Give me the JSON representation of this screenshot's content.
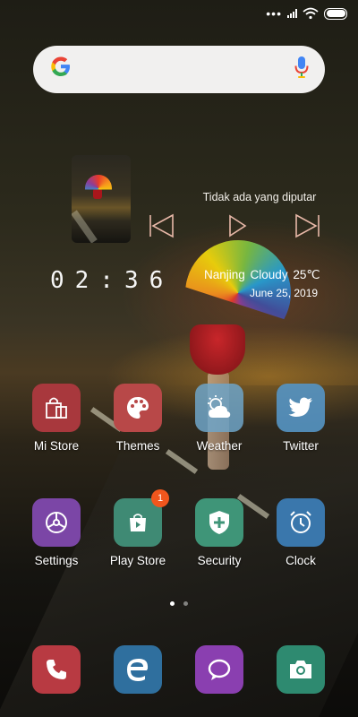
{
  "status_bar": {
    "notification_dots": "•••"
  },
  "search": {
    "logo": "G",
    "placeholder": ""
  },
  "music_widget": {
    "track_title": "Tidak ada yang diputar"
  },
  "clock_widget": {
    "time": "02:36"
  },
  "weather_widget": {
    "city": "Nanjing",
    "condition": "Cloudy",
    "temperature": "25℃",
    "date": "June  25, 2019"
  },
  "apps": [
    {
      "label": "Mi Store",
      "icon": "shopping-bag-icon",
      "color": "#a8383d"
    },
    {
      "label": "Themes",
      "icon": "palette-icon",
      "color": "#b84848"
    },
    {
      "label": "Weather",
      "icon": "weather-icon",
      "color": "#6aa3c7"
    },
    {
      "label": "Twitter",
      "icon": "twitter-icon",
      "color": "#5595c4"
    },
    {
      "label": "Settings",
      "icon": "gear-icon",
      "color": "#7b46a6"
    },
    {
      "label": "Play Store",
      "icon": "play-store-icon",
      "color": "#3f8a74",
      "badge": "1"
    },
    {
      "label": "Security",
      "icon": "shield-icon",
      "color": "#3f9578"
    },
    {
      "label": "Clock",
      "icon": "alarm-clock-icon",
      "color": "#3a77ac"
    }
  ],
  "dock": [
    {
      "icon": "phone-icon",
      "color": "#b83a42"
    },
    {
      "icon": "browser-icon",
      "color": "#2f6f9e"
    },
    {
      "icon": "message-icon",
      "color": "#8a3fb0"
    },
    {
      "icon": "camera-icon",
      "color": "#2e8a70"
    }
  ],
  "pages": {
    "total": 2,
    "current": 1
  }
}
